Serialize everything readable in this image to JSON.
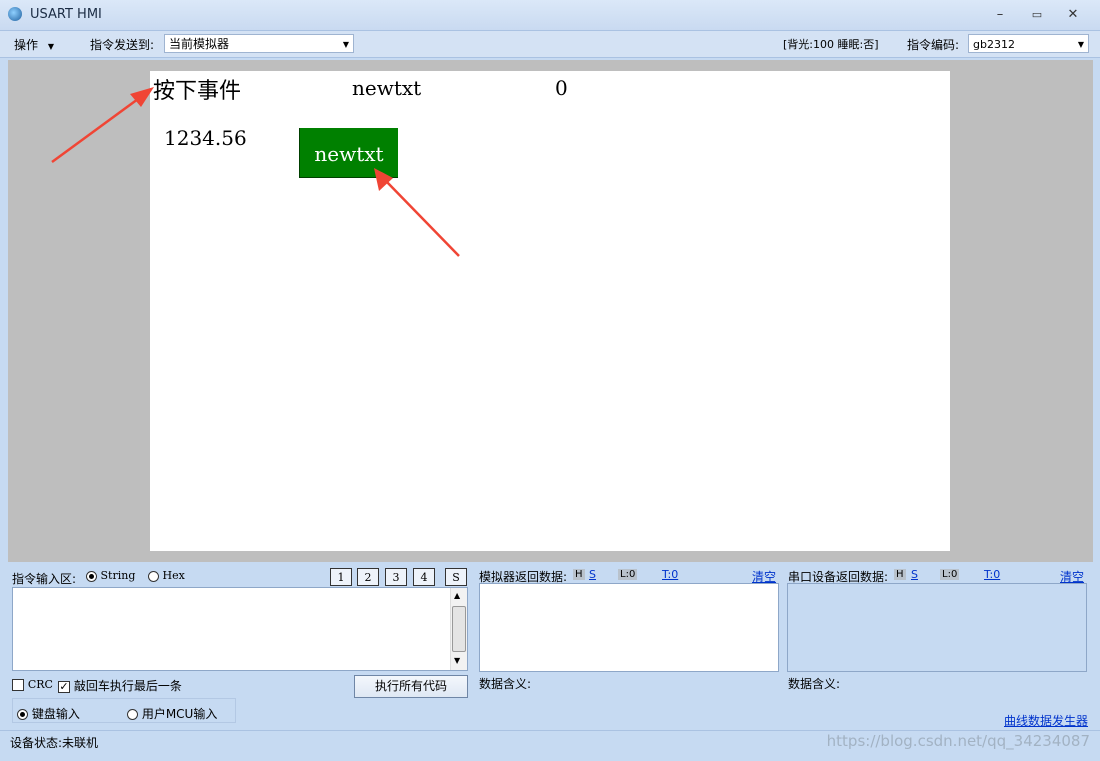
{
  "window": {
    "title": "USART HMI",
    "minimize": "–",
    "maximize": "▭",
    "close": "✕"
  },
  "menubar": {
    "operate_label": "操作",
    "send_to_label": "指令发送到:",
    "send_to_value": "当前模拟器",
    "status": "[背光:100  睡眠:否]",
    "encoding_label": "指令编码:",
    "encoding_value": "gb2312"
  },
  "screen": {
    "event_text": "按下事件",
    "text_newtxt": "newtxt",
    "value_zero": "0",
    "number_text": "1234.56",
    "button_label": "newtxt",
    "button_color": "#008000"
  },
  "input_panel": {
    "label": "指令输入区:",
    "mode_string": "String",
    "mode_hex": "Hex",
    "num_buttons": [
      "1",
      "2",
      "3",
      "4",
      "S"
    ],
    "crc_label": "CRC",
    "enter_label": "敲回车执行最后一条",
    "exec_all_label": "执行所有代码",
    "keyboard_label": "键盘输入",
    "mcu_label": "用户MCU输入"
  },
  "sim_panel": {
    "label": "模拟器返回数据:",
    "h": "H",
    "s": "S",
    "l": "L:0",
    "t": "T:0",
    "clear": "清空",
    "meaning": "数据含义:"
  },
  "serial_panel": {
    "label": "串口设备返回数据:",
    "h": "H",
    "s": "S",
    "l": "L:0",
    "t": "T:0",
    "clear": "清空",
    "meaning": "数据含义:"
  },
  "curve_generator": "曲线数据发生器",
  "statusbar": {
    "device_status": "设备状态:未联机"
  },
  "watermark": "https://blog.csdn.net/qq_34234087",
  "colors": {
    "annotation_arrow": "#f04535",
    "window_bg": "#c6daf2"
  }
}
